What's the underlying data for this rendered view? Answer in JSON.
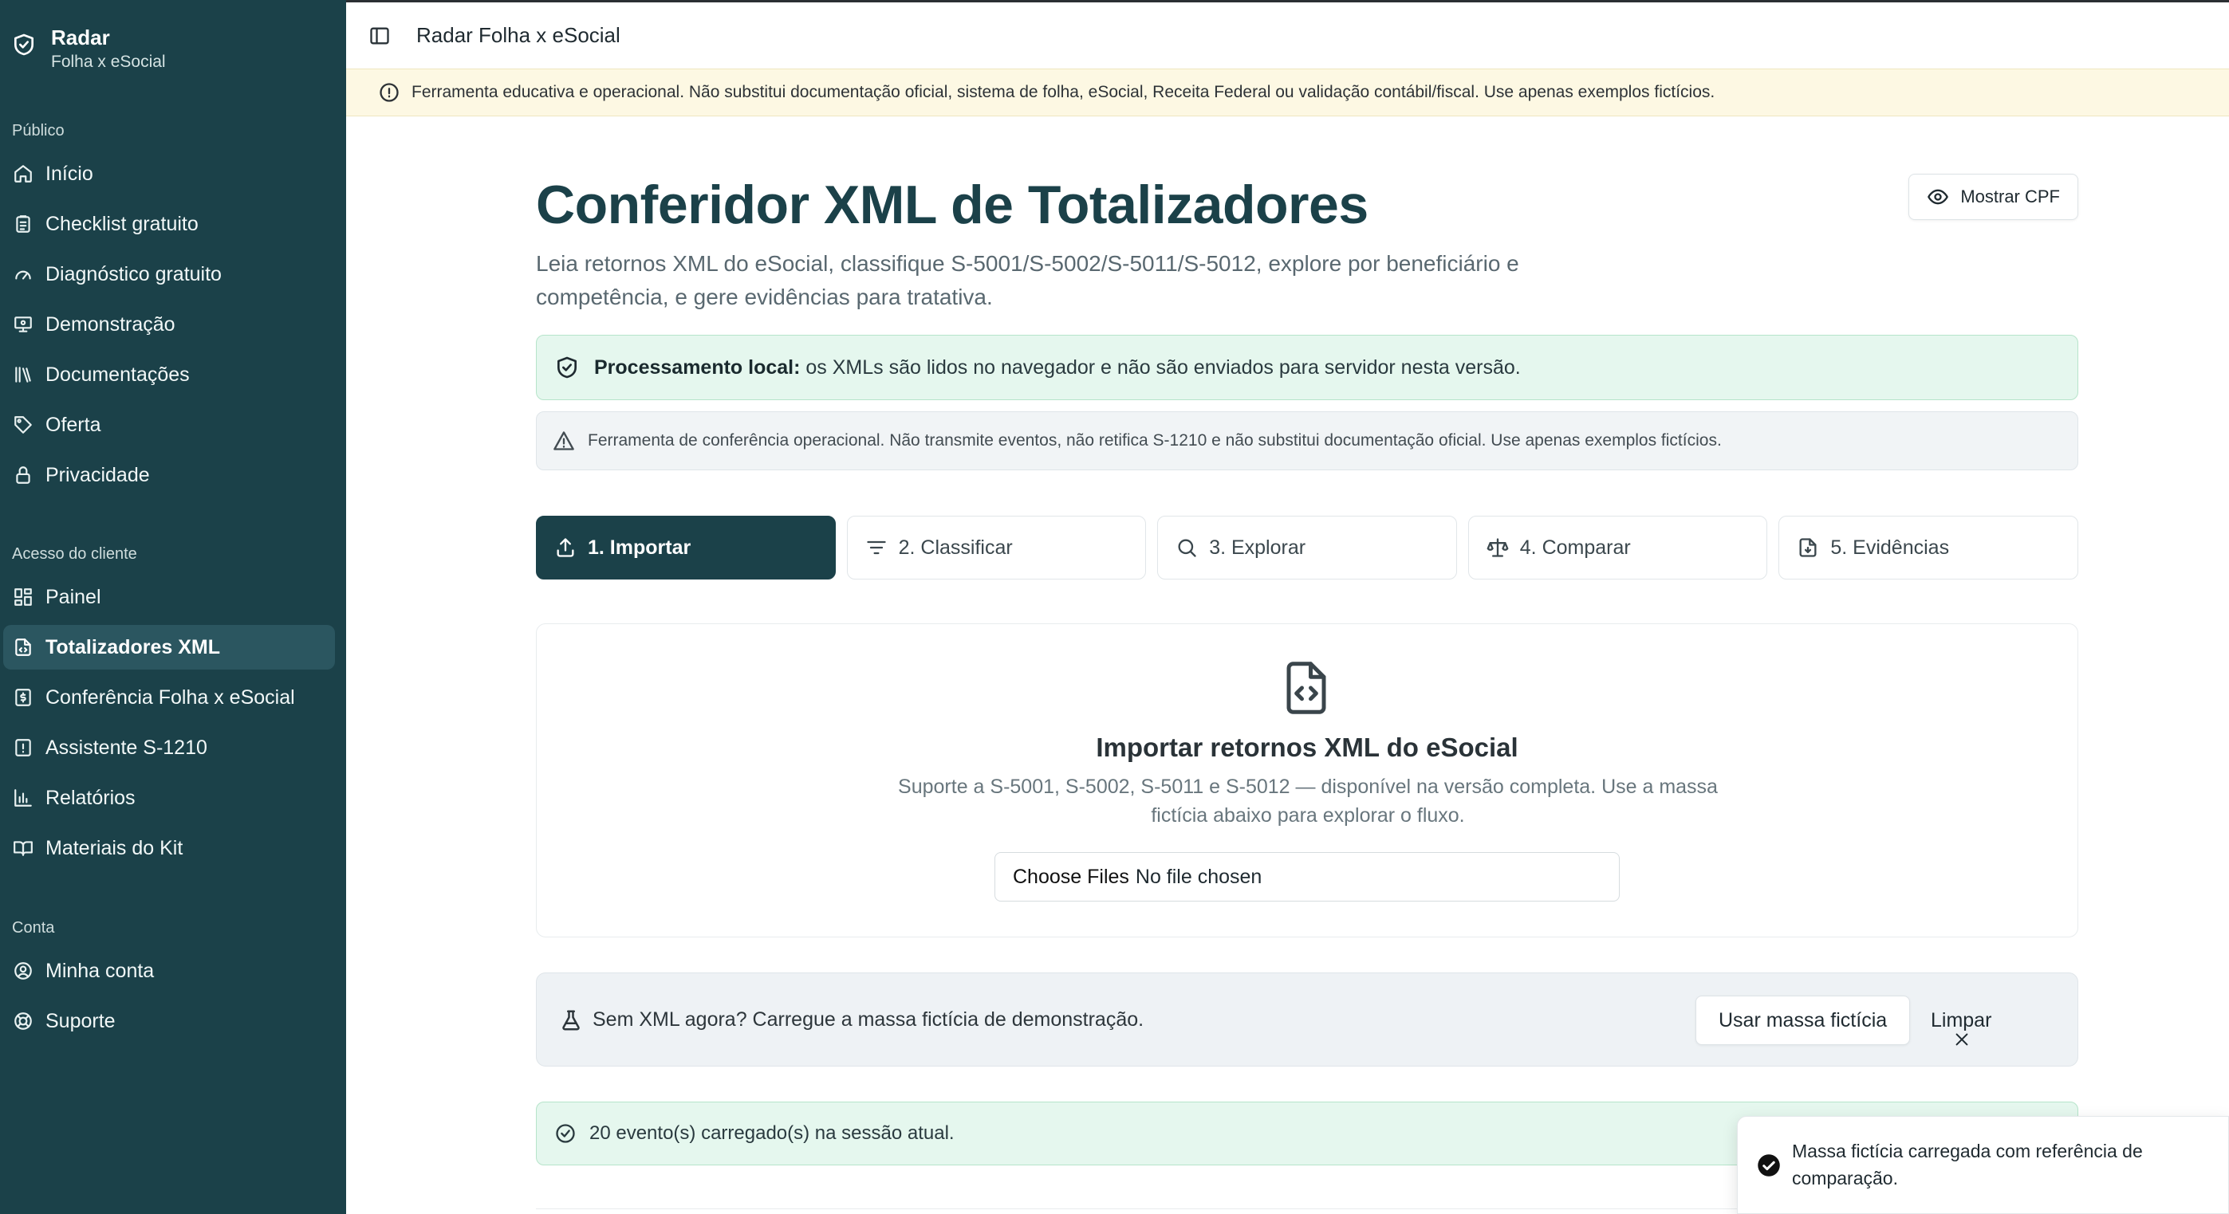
{
  "brand": {
    "title": "Radar",
    "subtitle": "Folha x eSocial"
  },
  "sidebar": {
    "sections": [
      {
        "heading": "Público",
        "items": [
          {
            "label": "Início",
            "icon": "home-icon"
          },
          {
            "label": "Checklist gratuito",
            "icon": "clipboard-icon"
          },
          {
            "label": "Diagnóstico gratuito",
            "icon": "gauge-icon"
          },
          {
            "label": "Demonstração",
            "icon": "presentation-icon"
          },
          {
            "label": "Documentações",
            "icon": "library-icon"
          },
          {
            "label": "Oferta",
            "icon": "tag-icon"
          },
          {
            "label": "Privacidade",
            "icon": "lock-icon"
          }
        ]
      },
      {
        "heading": "Acesso do cliente",
        "items": [
          {
            "label": "Painel",
            "icon": "dashboard-icon"
          },
          {
            "label": "Totalizadores XML",
            "icon": "file-code-icon",
            "active": true
          },
          {
            "label": "Conferência Folha x eSocial",
            "icon": "file-dollar-icon"
          },
          {
            "label": "Assistente S-1210",
            "icon": "file-alert-icon"
          },
          {
            "label": "Relatórios",
            "icon": "bar-chart-icon"
          },
          {
            "label": "Materiais do Kit",
            "icon": "book-icon"
          }
        ]
      },
      {
        "heading": "Conta",
        "items": [
          {
            "label": "Minha conta",
            "icon": "user-circle-icon"
          },
          {
            "label": "Suporte",
            "icon": "lifebuoy-icon"
          }
        ]
      }
    ]
  },
  "topbar": {
    "title": "Radar Folha x eSocial"
  },
  "notice": {
    "text": "Ferramenta educativa e operacional. Não substitui documentação oficial, sistema de folha, eSocial, Receita Federal ou validação contábil/fiscal. Use apenas exemplos fictícios."
  },
  "page": {
    "title": "Conferidor XML de Totalizadores",
    "description": "Leia retornos XML do eSocial, classifique S-5001/S-5002/S-5011/S-5012, explore por beneficiário e competência, e gere evidências para tratativa.",
    "show_cpf_label": "Mostrar CPF"
  },
  "local_processing": {
    "label": "Processamento local:",
    "text": " os XMLs são lidos no navegador e não são enviados para servidor nesta versão."
  },
  "warning": {
    "text": "Ferramenta de conferência operacional. Não transmite eventos, não retifica S-1210 e não substitui documentação oficial. Use apenas exemplos fictícios."
  },
  "tabs": [
    {
      "label": "1. Importar",
      "icon": "upload-icon",
      "active": true
    },
    {
      "label": "2. Classificar",
      "icon": "filter-icon"
    },
    {
      "label": "3. Explorar",
      "icon": "search-icon"
    },
    {
      "label": "4. Comparar",
      "icon": "scale-icon"
    },
    {
      "label": "5. Evidências",
      "icon": "file-download-icon"
    }
  ],
  "import": {
    "heading": "Importar retornos XML do eSocial",
    "text": "Suporte a S-5001, S-5002, S-5011 e S-5012 — disponível na versão completa. Use a massa fictícia abaixo para explorar o fluxo.",
    "file_button": "Choose Files",
    "file_status": "No file chosen"
  },
  "demo": {
    "text": "Sem XML agora? Carregue a massa fictícia de demonstração.",
    "use_button": "Usar massa fictícia",
    "clear_button": "Limpar"
  },
  "loaded": {
    "text": "20 evento(s) carregado(s) na sessão atual."
  },
  "toast": {
    "text": "Massa fictícia carregada com referência de comparação."
  },
  "colors": {
    "sidebar_bg": "#1b4149",
    "accent": "#1b4149",
    "success_bg": "#e5f7ee",
    "notice_bg": "#fdf8e3"
  }
}
